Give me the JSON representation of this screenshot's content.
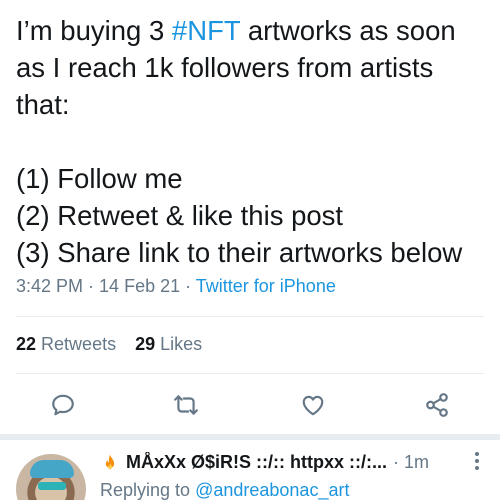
{
  "tweet": {
    "text_before_hashtag": "I’m buying 3 ",
    "hashtag": "#NFT",
    "text_after_hashtag": " artworks as soon as I reach 1k followers from artists that:\n\n(1) Follow me\n(2) Retweet & like this post\n(3) Share link to their artworks below",
    "time": "3:42 PM",
    "date": "14 Feb 21",
    "separator": " · ",
    "source": "Twitter for iPhone"
  },
  "stats": {
    "retweets_count": "22",
    "retweets_label": "Retweets",
    "likes_count": "29",
    "likes_label": "Likes"
  },
  "actions": [
    {
      "name": "reply",
      "icon": "reply-icon"
    },
    {
      "name": "retweet",
      "icon": "retweet-icon"
    },
    {
      "name": "like",
      "icon": "heart-icon"
    },
    {
      "name": "share",
      "icon": "share-icon"
    }
  ],
  "reply": {
    "name": "MÅxXx Ø$iR!S ::/:: httpxx ::/:...",
    "separator": "·",
    "time": "1m",
    "replying_prefix": "Replying to",
    "replying_handle": "@andreabonac_art"
  },
  "colors": {
    "text": "#14171a",
    "secondary": "#657786",
    "link": "#1b95e0",
    "divider": "#e6ecf0"
  }
}
